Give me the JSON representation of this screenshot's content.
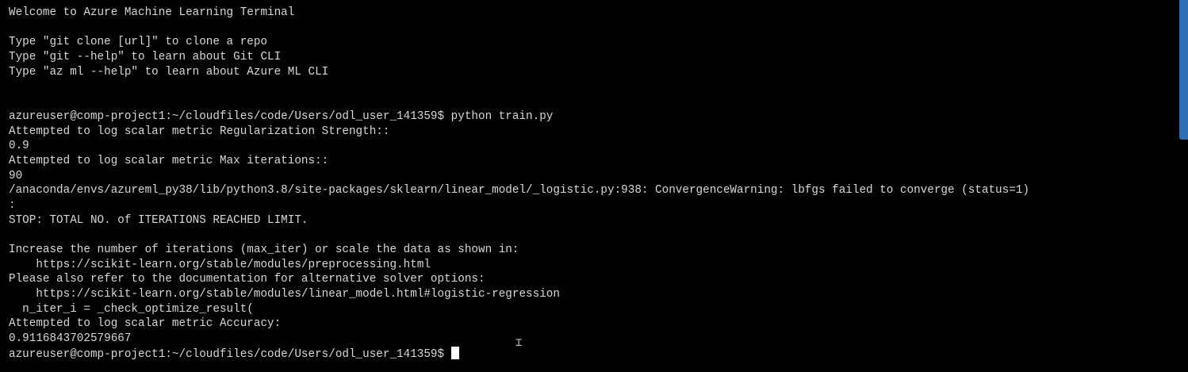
{
  "terminal": {
    "lines": [
      "Welcome to Azure Machine Learning Terminal",
      "",
      "Type \"git clone [url]\" to clone a repo",
      "Type \"git --help\" to learn about Git CLI",
      "Type \"az ml --help\" to learn about Azure ML CLI",
      "",
      "",
      "azureuser@comp-project1:~/cloudfiles/code/Users/odl_user_141359$ python train.py",
      "Attempted to log scalar metric Regularization Strength::",
      "0.9",
      "Attempted to log scalar metric Max iterations::",
      "90",
      "/anaconda/envs/azureml_py38/lib/python3.8/site-packages/sklearn/linear_model/_logistic.py:938: ConvergenceWarning: lbfgs failed to converge (status=1)",
      ":",
      "STOP: TOTAL NO. of ITERATIONS REACHED LIMIT.",
      "",
      "Increase the number of iterations (max_iter) or scale the data as shown in:",
      "    https://scikit-learn.org/stable/modules/preprocessing.html",
      "Please also refer to the documentation for alternative solver options:",
      "    https://scikit-learn.org/stable/modules/linear_model.html#logistic-regression",
      "  n_iter_i = _check_optimize_result(",
      "Attempted to log scalar metric Accuracy:",
      "0.9116843702579667"
    ],
    "prompt": "azureuser@comp-project1:~/cloudfiles/code/Users/odl_user_141359$"
  },
  "colors": {
    "background": "#000000",
    "text": "#d8d8d8",
    "cursor": "#ffffff",
    "side_tab": "#2f6fb5"
  }
}
